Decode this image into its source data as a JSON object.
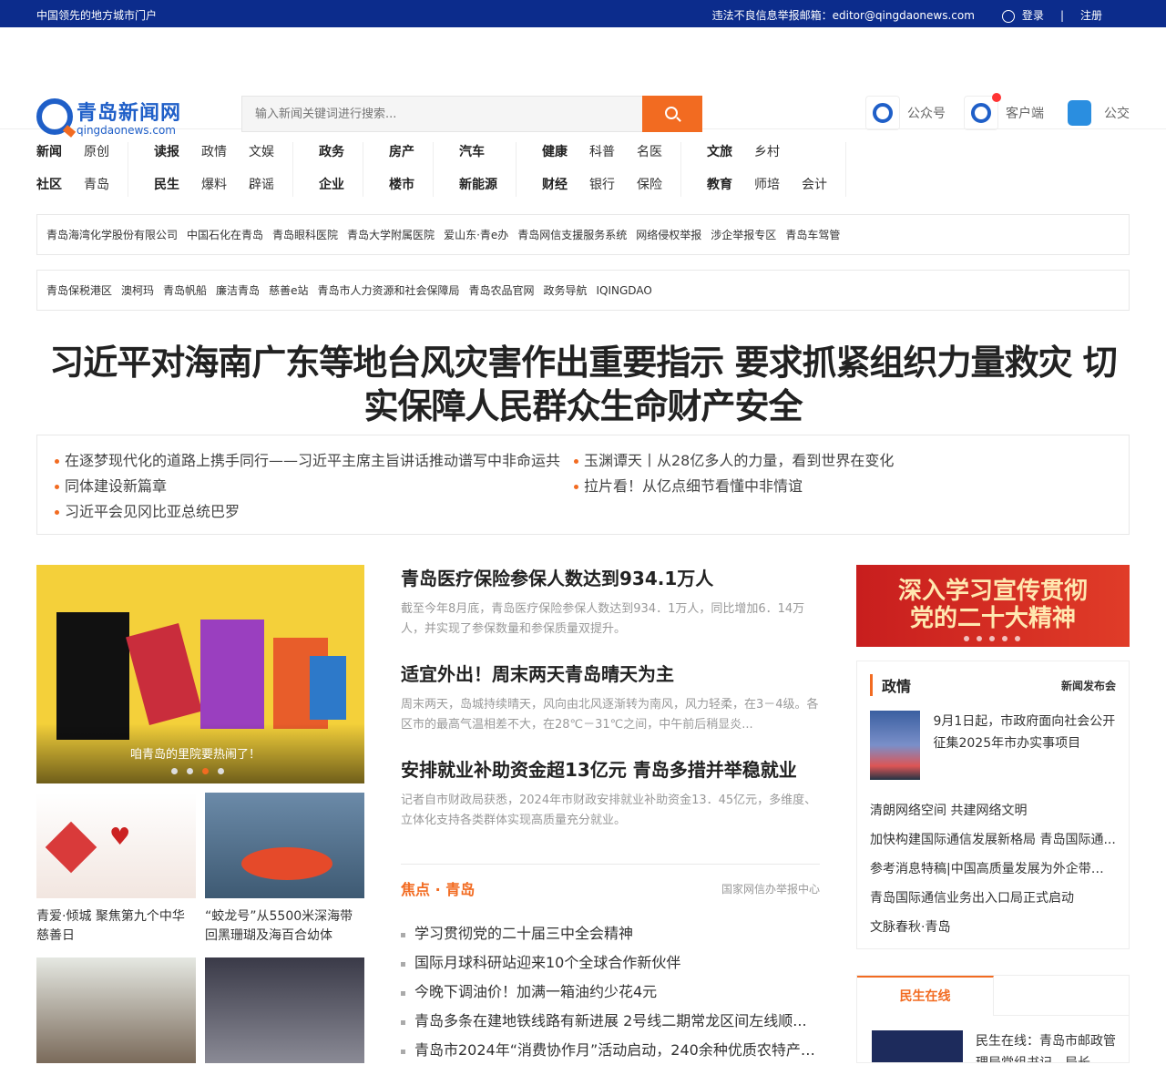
{
  "topbar": {
    "slogan": "中国领先的地方城市门户",
    "report": "违法不良信息举报邮箱：editor@qingdaonews.com",
    "login": "登录",
    "divider": "|",
    "register": "注册"
  },
  "logo": {
    "name": "青岛新闻网",
    "domain": "qingdaonews.com"
  },
  "search": {
    "placeholder": "输入新闻关键词进行搜索..."
  },
  "tools": {
    "wechat": "公众号",
    "client": "客户端",
    "bus": "公交"
  },
  "nav": [
    {
      "rows": [
        [
          "新闻",
          "原创"
        ],
        [
          "社区",
          "青岛"
        ]
      ]
    },
    {
      "rows": [
        [
          "读报",
          "政情",
          "文娱"
        ],
        [
          "民生",
          "爆料",
          "辟谣"
        ]
      ]
    },
    {
      "rows": [
        [
          "政务"
        ],
        [
          "企业"
        ]
      ]
    },
    {
      "rows": [
        [
          "房产"
        ],
        [
          "楼市"
        ]
      ]
    },
    {
      "rows": [
        [
          "汽车"
        ],
        [
          "新能源"
        ]
      ]
    },
    {
      "rows": [
        [
          "健康",
          "科普",
          "名医"
        ],
        [
          "财经",
          "银行",
          "保险"
        ]
      ]
    },
    {
      "rows": [
        [
          "文旅",
          "乡村"
        ],
        [
          "教育",
          "师培",
          "会计"
        ]
      ]
    }
  ],
  "links1": [
    "青岛海湾化学股份有限公司",
    "中国石化在青岛",
    "青岛眼科医院",
    "青岛大学附属医院",
    "爱山东·青e办",
    "青岛网信支援服务系统",
    "网络侵权举报",
    "涉企举报专区",
    "青岛车驾管"
  ],
  "links2": [
    "青岛保税港区",
    "澳柯玛",
    "青岛帆船",
    "廉洁青岛",
    "慈善e站",
    "青岛市人力资源和社会保障局",
    "青岛农品官网",
    "政务导航",
    "IQINGDAO"
  ],
  "headline": {
    "line1": "习近平对海南广东等地台风灾害作出重要指示 要求抓紧组织力量救灾 切",
    "line2": "实保障人民群众生命财产安全"
  },
  "subnews": [
    "在逐梦现代化的道路上携手同行——习近平主席主旨讲话推动谱写中非命运共",
    "同体建设新篇章",
    "习近平会见冈比亚总统巴罗",
    "玉渊谭天丨从28亿多人的力量，看到世界在变化",
    "拉片看！从亿点细节看懂中非情谊"
  ],
  "slider": {
    "caption": "咱青岛的里院要热闹了！",
    "active_dot": 3,
    "dot_count": 4
  },
  "thumbs": [
    {
      "caption": "青爱·倾城 聚焦第九个中华慈善日"
    },
    {
      "caption": "“蛟龙号”从5500米深海带回黑珊瑚及海百合幼体"
    },
    {
      "caption": ""
    },
    {
      "caption": ""
    }
  ],
  "stories": [
    {
      "title": "青岛医疗保险参保人数达到934.1万人",
      "summary": "截至今年8月底，青岛医疗保险参保人数达到934．1万人，同比增加6．14万人，并实现了参保数量和参保质量双提升。"
    },
    {
      "title": "适宜外出！周末两天青岛晴天为主",
      "summary": "周末两天，岛城持续晴天，风向由北风逐渐转为南风，风力轻柔，在3－4级。各区市的最高气温相差不大，在28℃－31℃之间，中午前后稍显炎..."
    },
    {
      "title": "安排就业补助资金超13亿元 青岛多措并举稳就业",
      "summary": "记者自市财政局获悉，2024年市财政安排就业补助资金13．45亿元，多维度、立体化支持各类群体实现高质量充分就业。"
    }
  ],
  "focus": {
    "title": "焦点 · 青岛",
    "source": "国家网信办举报中心",
    "items": [
      "学习贯彻党的二十届三中全会精神",
      "国际月球科研站迎来10个全球合作新伙伴",
      "今晚下调油价！加满一箱油约少花4元",
      "青岛多条在建地铁线路有新进展 2号线二期常龙区间左线顺...",
      "青岛市2024年“消费协作月”活动启动，240余种优质农特产品..."
    ]
  },
  "banner": {
    "line1": "深入学习宣传贯彻",
    "line2": "党的二十大精神"
  },
  "zhengqing": {
    "title": "政情",
    "more": "新闻发布会",
    "feature": "9月1日起，市政府面向社会公开征集2025年市办实事项目",
    "items": [
      "清朗网络空间 共建网络文明",
      "加快构建国际通信发展新格局 青岛国际通...",
      "参考消息特稿|中国高质量发展为外企带来...",
      "青岛国际通信业务出入口局正式启动",
      "文脉春秋·青岛"
    ]
  },
  "minsheng": {
    "tab": "民生在线",
    "text": "民生在线：青岛市邮政管理局党组书记、局长"
  },
  "colors": {
    "brand": "#0c2c8c",
    "accent": "#f26b21"
  }
}
